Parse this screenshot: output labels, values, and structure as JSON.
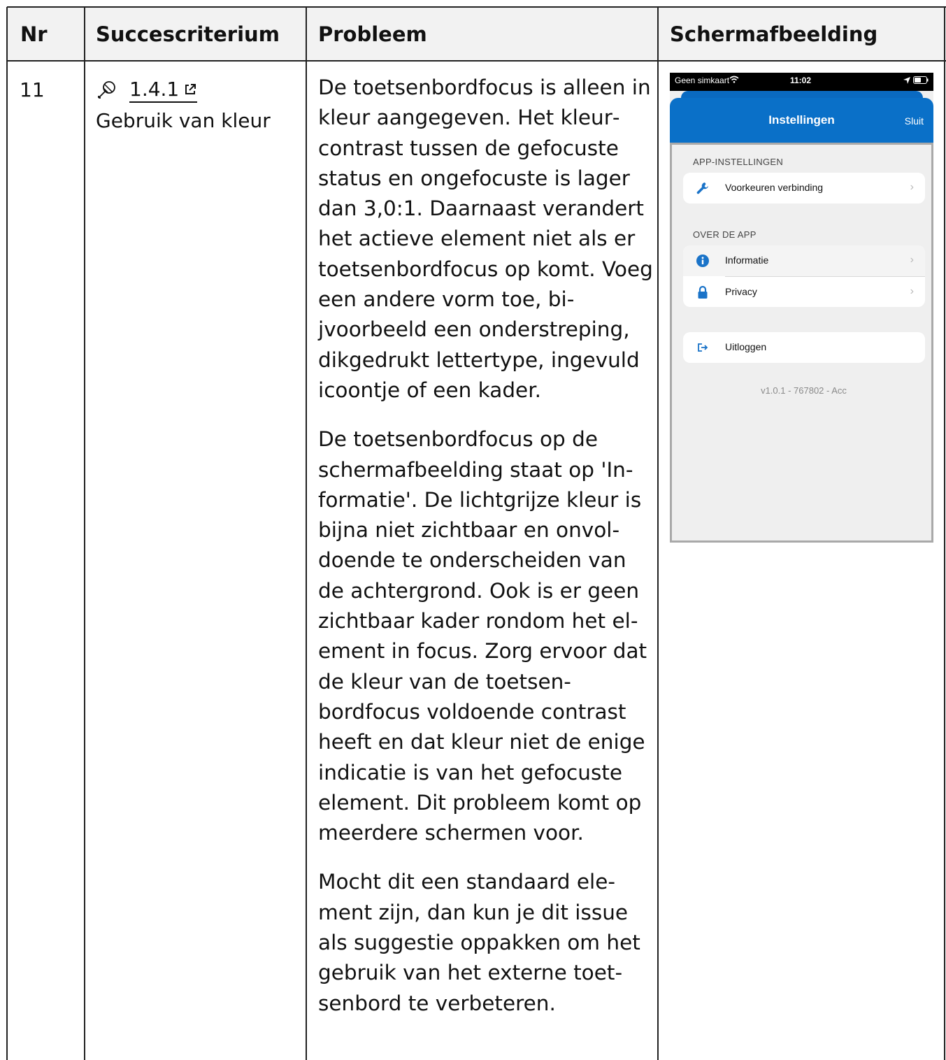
{
  "table": {
    "headers": [
      "Nr",
      "Succescriterium",
      "Probleem",
      "Schermafbeelding"
    ],
    "row": {
      "nr": "11",
      "criterion": {
        "icon": "eye-dropper-icon",
        "link_label": "1.4.1",
        "link_icon": "external-link-icon",
        "name": "Gebruik van kleur"
      },
      "problem": [
        "De toetsenbordfocus is alleen in kleur aangegeven. Het kleur­contrast tussen de gefocuste status en ongefocuste is lager dan 3,0:1. Daarnaast verandert het actieve element niet als er toetsenbordfocus op komt. Voeg een andere vorm toe, bi­jvoorbeeld een onderstreping, dikgedrukt lettertype, ingevuld icoontje of een kader.",
        "De toetsenbordfocus op de schermafbeelding staat op 'In­formatie'. De lichtgrijze kleur is bijna niet zichtbaar en onvol­doende te onderscheiden van de achtergrond. Ook is er geen zichtbaar kader rondom het el­ement in focus. Zorg ervoor dat de kleur van de toetsen­bordfocus voldoende contrast heeft en dat kleur niet de enige indicatie is van het gefocuste element. Dit probleem komt op meerdere schermen voor.",
        "Mocht dit een standaard ele­ment zijn, dan kun je dit issue als suggestie oppakken om het gebruik van het externe toet­senbord te verbeteren."
      ]
    }
  },
  "screenshot": {
    "status_bar": {
      "carrier": "Geen simkaart",
      "time": "11:02"
    },
    "nav_title": "Instellingen",
    "nav_close": "Sluit",
    "section_app": "APP-INSTELLINGEN",
    "row_connection": "Voorkeuren verbinding",
    "section_about": "OVER DE APP",
    "row_info": "Informatie",
    "row_privacy": "Privacy",
    "row_logout": "Uitloggen",
    "version": "v1.0.1 - 767802 - Acc",
    "colors": {
      "nav_blue": "#0a70c8",
      "icon_blue": "#1a73c8",
      "focus_gray": "#f4f4f4"
    }
  }
}
